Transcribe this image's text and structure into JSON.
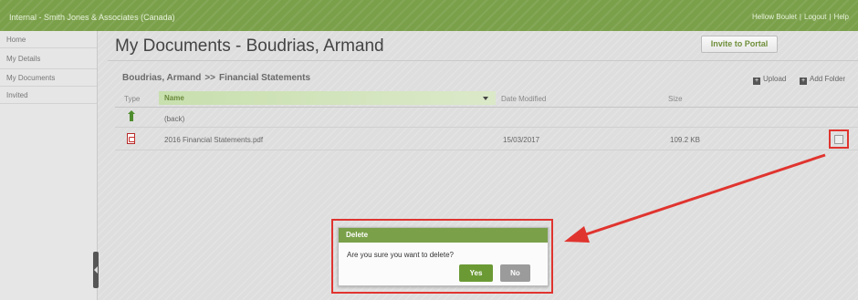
{
  "topbar": {
    "brand": "Internal - Smith Jones & Associates (Canada)",
    "user": "Hellow Boulet",
    "logout": "Logout",
    "help": "Help",
    "sep": "|"
  },
  "sidebar": {
    "items": [
      {
        "label": "Home"
      },
      {
        "label": "My Details"
      },
      {
        "label": "My Documents"
      },
      {
        "label": "Invited"
      }
    ]
  },
  "page": {
    "title": "My Documents - Boudrias, Armand",
    "invite_label": "Invite to Portal"
  },
  "folder": {
    "owner": "Boudrias, Armand",
    "separator": ">>",
    "name": "Financial Statements",
    "upload_label": "Upload",
    "add_folder_label": "Add Folder"
  },
  "table": {
    "headers": {
      "type": "Type",
      "name": "Name",
      "date": "Date Modified",
      "size": "Size"
    },
    "rows": [
      {
        "name": "(back)",
        "date": "",
        "size": "",
        "icon": "up-arrow-icon"
      },
      {
        "name": "2016 Financial Statements.pdf",
        "date": "15/03/2017",
        "size": "109.2 KB",
        "icon": "pdf-icon"
      }
    ]
  },
  "dialog": {
    "title": "Delete",
    "message": "Are you sure you want to delete?",
    "yes_label": "Yes",
    "no_label": "No"
  },
  "colors": {
    "brand_green": "#7aa04a",
    "annotation_red": "#e0342f"
  }
}
